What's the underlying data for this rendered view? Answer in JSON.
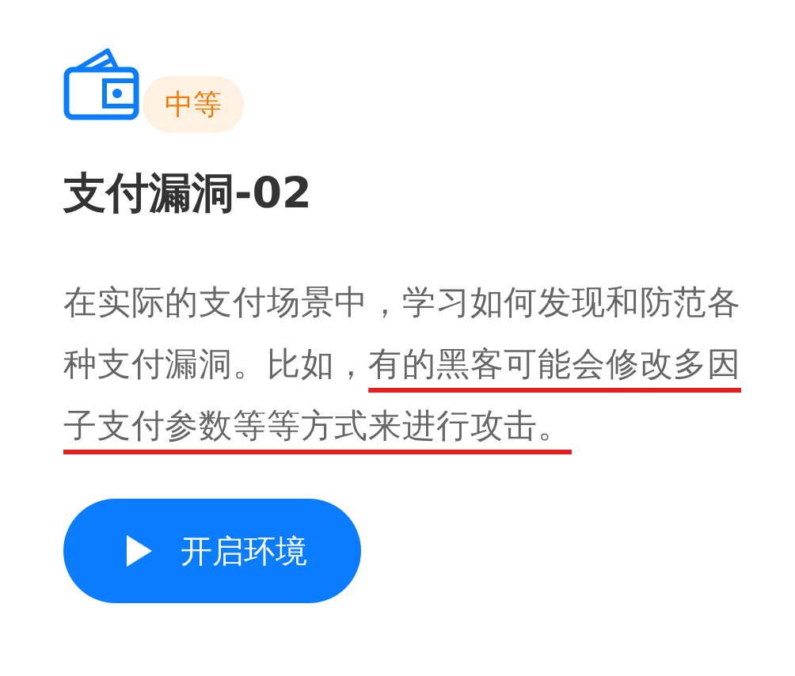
{
  "badge": {
    "label": "中等"
  },
  "title": "支付漏洞-02",
  "description": [
    {
      "text": "在实际的支付场景中，学习如何发现和防范各种支付漏洞。比如，",
      "underlined": false
    },
    {
      "text": "有的黑客可能会修改多因子支付参数等等方式来进行攻击。",
      "underlined": true
    }
  ],
  "button": {
    "label": "开启环境"
  }
}
